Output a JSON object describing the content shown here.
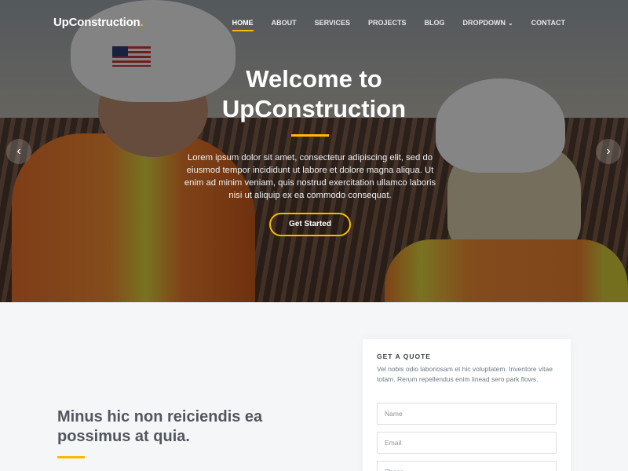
{
  "brand": {
    "name": "UpConstruction",
    "dot": ".",
    "accent": "#feb900"
  },
  "nav": {
    "items": [
      {
        "label": "HOME",
        "active": true
      },
      {
        "label": "ABOUT"
      },
      {
        "label": "SERVICES"
      },
      {
        "label": "PROJECTS"
      },
      {
        "label": "BLOG"
      },
      {
        "label": "DROPDOWN",
        "icon": "chevron-down-icon"
      },
      {
        "label": "CONTACT"
      }
    ]
  },
  "hero": {
    "title_line1": "Welcome to",
    "title_line2": "UpConstruction",
    "text": "Lorem ipsum dolor sit amet, consectetur adipiscing elit, sed do eiusmod tempor incididunt ut labore et dolore magna aliqua. Ut enim ad minim veniam, quis nostrud exercitation ullamco laboris nisi ut aliquip ex ea commodo consequat.",
    "button": "Get Started",
    "prev_icon": "chevron-left-icon",
    "next_icon": "chevron-right-icon",
    "prev_glyph": "‹",
    "next_glyph": "›"
  },
  "section": {
    "heading": "Minus hic non reiciendis ea possimus at quia."
  },
  "quote": {
    "title": "GET A QUOTE",
    "text": "Vel nobis odio laboriosam et hic voluptatem. Inventore vitae totam. Rerum repellendus enim linead sero park flows.",
    "fields": {
      "name_placeholder": "Name",
      "email_placeholder": "Email",
      "phone_placeholder": "Phone"
    }
  }
}
